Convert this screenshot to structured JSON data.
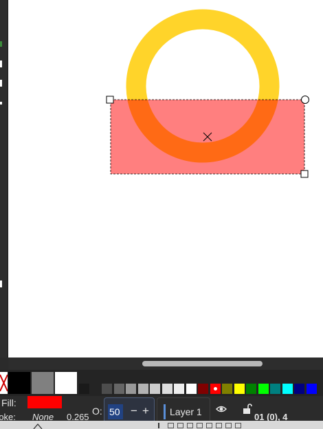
{
  "canvas": {
    "objects": [
      {
        "name": "yellow-ring",
        "stroke": "#ffd42a",
        "fill": "none"
      },
      {
        "name": "red-rectangle",
        "fill": "#ff0000",
        "opacity_percent": 50,
        "selected": true
      }
    ]
  },
  "palette": {
    "none_swatch_icon": "none-x-icon",
    "large": [
      "#000000",
      "#808080",
      "#ffffff",
      "#1a1a1a"
    ],
    "small": [
      "#4d4d4d",
      "#666666",
      "#999999",
      "#b3b3b3",
      "#cccccc",
      "#dddddd",
      "#eeeeee",
      "#ffffff",
      "#800000",
      "#ff0000",
      "#808000",
      "#ffff00",
      "#008000",
      "#00ff00",
      "#008080",
      "#00ffff",
      "#000080",
      "#0000ff"
    ]
  },
  "status": {
    "fill_label": "Fill:",
    "fill_color": "#ff0000",
    "stroke_label": "roke:",
    "stroke_value": "None",
    "stroke_width": "0.265",
    "opacity_label": "O:",
    "opacity_value": "50",
    "minus": "−",
    "plus": "+",
    "layer_name": "Layer 1",
    "visibility_icon": "eye-icon",
    "lock_icon": "unlock-icon",
    "position_readout": "01 (0), 4"
  }
}
